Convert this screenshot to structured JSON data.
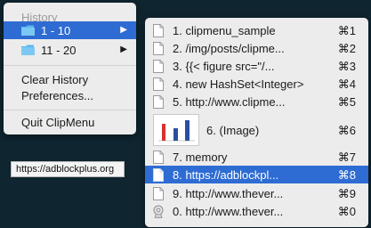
{
  "main_menu": {
    "header": "History",
    "groups": [
      {
        "label": "1 - 10",
        "arrow": "▶"
      },
      {
        "label": "11 - 20",
        "arrow": "▶"
      }
    ],
    "actions": {
      "clear": "Clear History",
      "prefs": "Preferences...",
      "quit": "Quit ClipMenu"
    }
  },
  "submenu": {
    "items": [
      {
        "label": "1. clipmenu_sample",
        "shortcut": "⌘1"
      },
      {
        "label": "2. /img/posts/clipme...",
        "shortcut": "⌘2"
      },
      {
        "label": "3. {{< figure src=\"/...",
        "shortcut": "⌘3"
      },
      {
        "label": "4. new HashSet<Integer>",
        "shortcut": "⌘4"
      },
      {
        "label": "5. http://www.clipme...",
        "shortcut": "⌘5"
      },
      {
        "label": "6. (Image)",
        "shortcut": "⌘6"
      },
      {
        "label": "7. memory",
        "shortcut": "⌘7"
      },
      {
        "label": "8. https://adblockpl...",
        "shortcut": "⌘8"
      },
      {
        "label": "9. http://www.thever...",
        "shortcut": "⌘9"
      },
      {
        "label": "0. http://www.thever...",
        "shortcut": "⌘0"
      }
    ]
  },
  "tooltip": "https://adblockplus.org",
  "colors": {
    "accent": "#2e6cd3",
    "folder": "#5ab8f0"
  }
}
